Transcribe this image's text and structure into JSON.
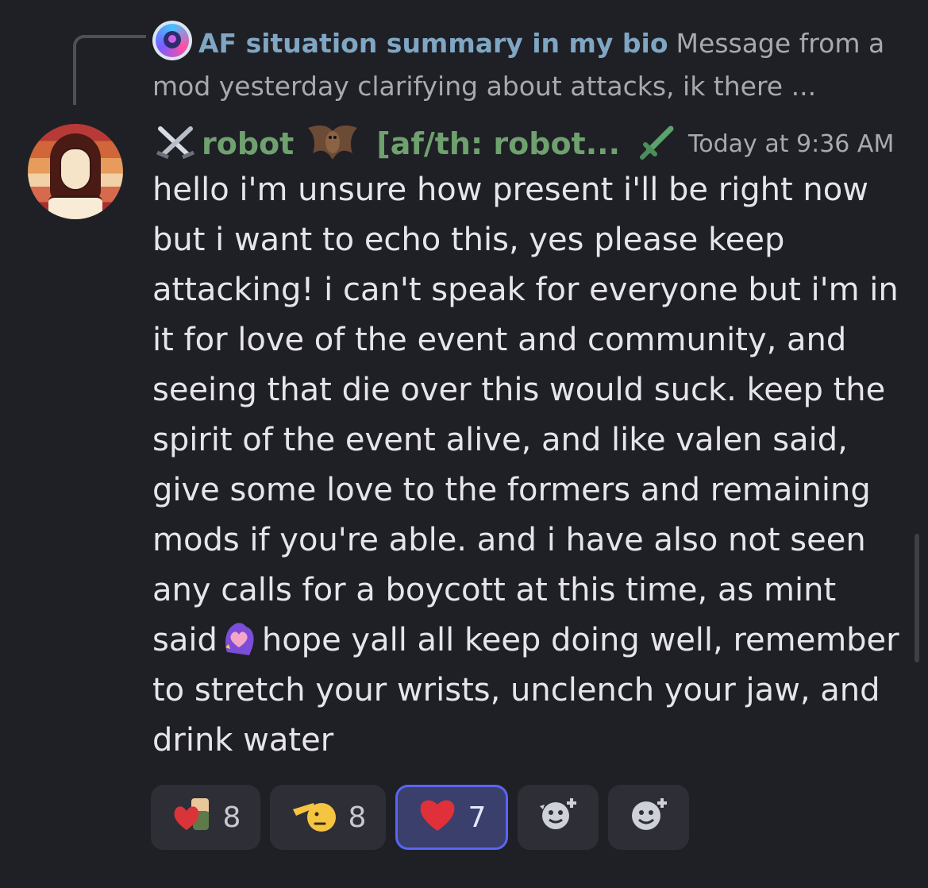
{
  "reply": {
    "author": "AF situation summary in my bio",
    "preview": "Message from a mod yesterday clarifying about attacks, ik there ..."
  },
  "message": {
    "author": "robot",
    "tag": "[af/th: robot...",
    "timestamp": "Today at 9:36 AM",
    "text_part1": "hello i'm unsure how present i'll be right now but i want to echo this, yes please keep attacking! i can't speak for everyone but i'm in it for love of the event and community, and seeing that die over this would suck. keep the spirit of the event alive, and like valen said, give some love to the formers and remaining mods if you're able. and i have also not seen any calls for a boycott at this time, as mint said",
    "text_part2": "hope yall all keep doing well, remember to stretch your wrists, unclench your jaw, and drink water"
  },
  "reactions": [
    {
      "icon": "hug-heart-emoji",
      "count": "8",
      "active": false
    },
    {
      "icon": "salute-emoji",
      "count": "8",
      "active": false
    },
    {
      "icon": "red-heart-emoji",
      "count": "7",
      "active": true
    }
  ],
  "add_reaction_buttons": [
    {
      "icon": "add-super-reaction-icon"
    },
    {
      "icon": "add-reaction-icon"
    }
  ],
  "colors": {
    "background": "#1f1f26",
    "role_green": "#6fa16f",
    "reply_author": "#7fa6c2",
    "active_reaction_border": "#5865f2"
  }
}
